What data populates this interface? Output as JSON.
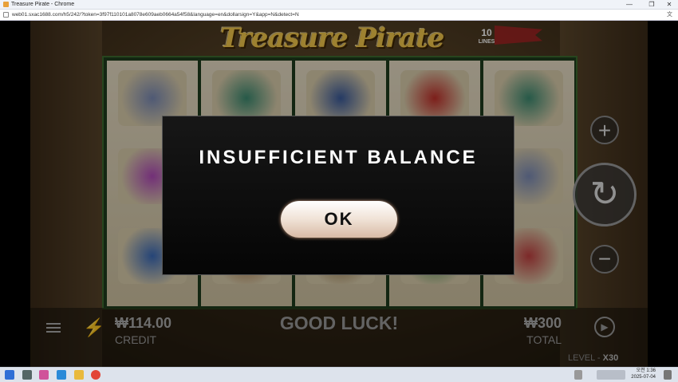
{
  "window": {
    "title": "Treasure Pirate - Chrome",
    "minimize": "—",
    "maximize": "❐",
    "close": "✕"
  },
  "urlbar": {
    "url": "web01.sxac1688.com/h5/242/?token=3f97f110101a8078e609aeb0664a54f58&language=en&dollarsign=Y&app=N&detect=N"
  },
  "game": {
    "logo_text": "Treasure Pirate",
    "lines_number": "10",
    "lines_label": "LINES"
  },
  "modal": {
    "message": "INSUFFICIENT BALANCE",
    "ok_label": "OK"
  },
  "controls": {
    "plus": "+",
    "spin": "↻",
    "minus": "−",
    "autoplay": "▶"
  },
  "bottom_bar": {
    "credit_value": "₩114.00",
    "credit_label": "CREDIT",
    "status": "GOOD LUCK!",
    "total_value": "₩300",
    "total_label": "TOTAL",
    "level_label": "LEVEL -",
    "level_value": "X30"
  },
  "taskbar": {
    "time": "오전 1:36",
    "date": "2025-07-04"
  },
  "colors": {
    "modal_bg": "#0b0b0b",
    "ok_button": "#f0e2d6",
    "logo_gold": "#f2c64b"
  }
}
